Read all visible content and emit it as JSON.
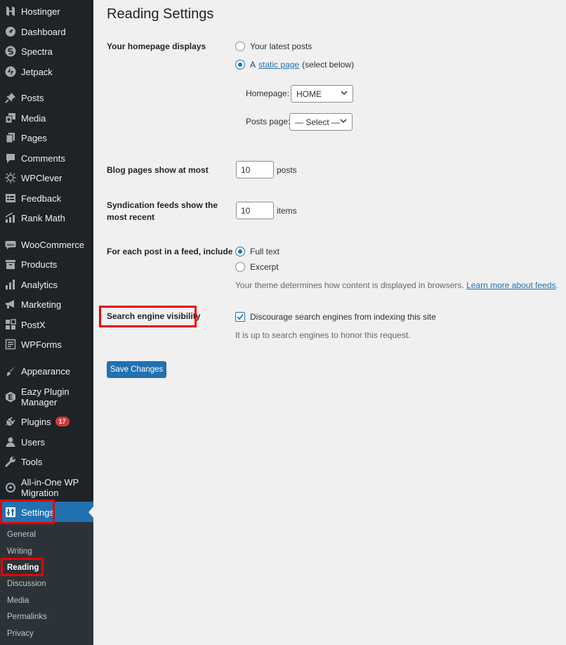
{
  "sidebar": {
    "items": [
      {
        "label": "Hostinger",
        "icon": "hostinger-icon"
      },
      {
        "label": "Dashboard",
        "icon": "dashboard-icon"
      },
      {
        "label": "Spectra",
        "icon": "spectra-icon"
      },
      {
        "label": "Jetpack",
        "icon": "jetpack-icon"
      },
      {
        "label": "Posts",
        "icon": "pin-icon"
      },
      {
        "label": "Media",
        "icon": "media-icon"
      },
      {
        "label": "Pages",
        "icon": "pages-icon"
      },
      {
        "label": "Comments",
        "icon": "comment-icon"
      },
      {
        "label": "WPClever",
        "icon": "wpclever-icon"
      },
      {
        "label": "Feedback",
        "icon": "feedback-icon"
      },
      {
        "label": "Rank Math",
        "icon": "rank-math-icon"
      },
      {
        "label": "WooCommerce",
        "icon": "woocommerce-icon"
      },
      {
        "label": "Products",
        "icon": "archive-icon"
      },
      {
        "label": "Analytics",
        "icon": "bar-chart-icon"
      },
      {
        "label": "Marketing",
        "icon": "megaphone-icon"
      },
      {
        "label": "PostX",
        "icon": "postx-icon"
      },
      {
        "label": "WPForms",
        "icon": "wpforms-icon"
      },
      {
        "label": "Appearance",
        "icon": "brush-icon"
      },
      {
        "label": "Eazy Plugin\nManager",
        "label_line1": "Eazy Plugin",
        "label_line2": "Manager",
        "icon": "eazy-plugin-icon"
      },
      {
        "label": "Plugins",
        "icon": "plugin-icon",
        "badge": "17"
      },
      {
        "label": "Users",
        "icon": "user-icon"
      },
      {
        "label": "Tools",
        "icon": "wrench-icon"
      },
      {
        "label": "All-in-One WP\nMigration",
        "label_line1": "All-in-One WP",
        "label_line2": "Migration",
        "icon": "migration-icon"
      },
      {
        "label": "Settings",
        "icon": "settings-icon"
      }
    ],
    "submenu": [
      "General",
      "Writing",
      "Reading",
      "Discussion",
      "Media",
      "Permalinks",
      "Privacy"
    ],
    "current_submenu": "Reading"
  },
  "page": {
    "title": "Reading Settings",
    "homepage_displays": {
      "label": "Your homepage displays",
      "option_latest": "Your latest posts",
      "option_static_prefix": "A",
      "option_static_link": "static page",
      "option_static_suffix": "(select below)",
      "selected": "static page",
      "homepage_label": "Homepage:",
      "homepage_value": "HOME",
      "posts_page_label": "Posts page:",
      "posts_page_value": "— Select —"
    },
    "blog_pages": {
      "label": "Blog pages show at most",
      "value": "10",
      "unit": "posts"
    },
    "syndication": {
      "label_line1": "Syndication feeds show the",
      "label_line2": "most recent",
      "value": "10",
      "unit": "items"
    },
    "feed_include": {
      "label": "For each post in a feed, include",
      "option_full": "Full text",
      "option_excerpt": "Excerpt",
      "selected": "Full text",
      "description": "Your theme determines how content is displayed in browsers.",
      "link": "Learn more about feeds",
      "link_suffix": "."
    },
    "search_visibility": {
      "label": "Search engine visibility",
      "checkbox_label": "Discourage search engines from indexing this site",
      "checked": true,
      "description": "It is up to search engines to honor this request."
    },
    "save_button": "Save Changes"
  },
  "colors": {
    "sidebar_bg": "#1d2327",
    "submenu_bg": "#2c3338",
    "accent": "#2271b1",
    "highlight_box": "#ee0000",
    "badge": "#d63638"
  }
}
